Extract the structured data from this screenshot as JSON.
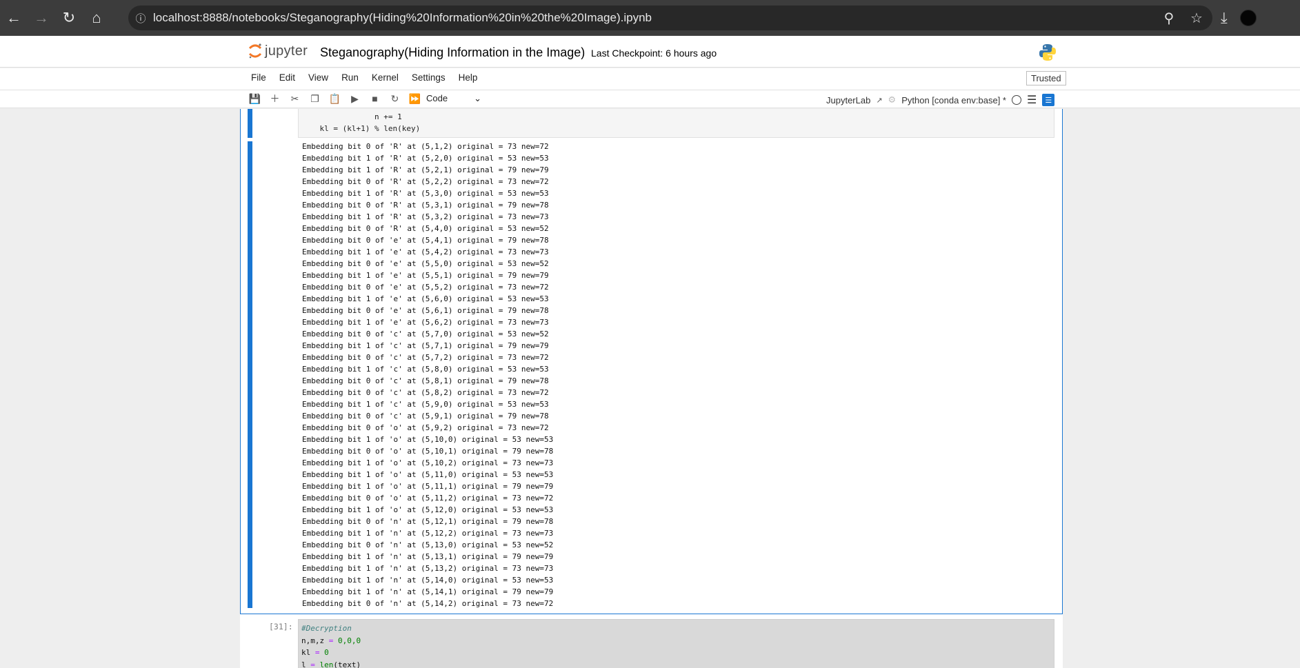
{
  "browser": {
    "url": "localhost:8888/notebooks/Steganography(Hiding%20Information%20in%20the%20Image).ipynb"
  },
  "header": {
    "logo_text": "jupyter",
    "notebook_title": "Steganography(Hiding Information in the Image)",
    "checkpoint": "Last Checkpoint: 6 hours ago"
  },
  "menu": [
    "File",
    "Edit",
    "View",
    "Run",
    "Kernel",
    "Settings",
    "Help"
  ],
  "trusted_label": "Trusted",
  "toolbar": {
    "cell_type": "Code",
    "jupyterlab_label": "JupyterLab",
    "kernel_label": "Python [conda env:base] *"
  },
  "code_tail": {
    "line1": "                n += 1",
    "line2": "    kl = (kl+1) % len(key)"
  },
  "output_lines": [
    "Embedding bit 0 of 'R' at (5,1,2) original = 73 new=72",
    "Embedding bit 1 of 'R' at (5,2,0) original = 53 new=53",
    "Embedding bit 1 of 'R' at (5,2,1) original = 79 new=79",
    "Embedding bit 0 of 'R' at (5,2,2) original = 73 new=72",
    "Embedding bit 1 of 'R' at (5,3,0) original = 53 new=53",
    "Embedding bit 0 of 'R' at (5,3,1) original = 79 new=78",
    "Embedding bit 1 of 'R' at (5,3,2) original = 73 new=73",
    "Embedding bit 0 of 'R' at (5,4,0) original = 53 new=52",
    "Embedding bit 0 of 'e' at (5,4,1) original = 79 new=78",
    "Embedding bit 1 of 'e' at (5,4,2) original = 73 new=73",
    "Embedding bit 0 of 'e' at (5,5,0) original = 53 new=52",
    "Embedding bit 1 of 'e' at (5,5,1) original = 79 new=79",
    "Embedding bit 0 of 'e' at (5,5,2) original = 73 new=72",
    "Embedding bit 1 of 'e' at (5,6,0) original = 53 new=53",
    "Embedding bit 0 of 'e' at (5,6,1) original = 79 new=78",
    "Embedding bit 1 of 'e' at (5,6,2) original = 73 new=73",
    "Embedding bit 0 of 'c' at (5,7,0) original = 53 new=52",
    "Embedding bit 1 of 'c' at (5,7,1) original = 79 new=79",
    "Embedding bit 0 of 'c' at (5,7,2) original = 73 new=72",
    "Embedding bit 1 of 'c' at (5,8,0) original = 53 new=53",
    "Embedding bit 0 of 'c' at (5,8,1) original = 79 new=78",
    "Embedding bit 0 of 'c' at (5,8,2) original = 73 new=72",
    "Embedding bit 1 of 'c' at (5,9,0) original = 53 new=53",
    "Embedding bit 0 of 'c' at (5,9,1) original = 79 new=78",
    "Embedding bit 0 of 'o' at (5,9,2) original = 73 new=72",
    "Embedding bit 1 of 'o' at (5,10,0) original = 53 new=53",
    "Embedding bit 0 of 'o' at (5,10,1) original = 79 new=78",
    "Embedding bit 1 of 'o' at (5,10,2) original = 73 new=73",
    "Embedding bit 1 of 'o' at (5,11,0) original = 53 new=53",
    "Embedding bit 1 of 'o' at (5,11,1) original = 79 new=79",
    "Embedding bit 0 of 'o' at (5,11,2) original = 73 new=72",
    "Embedding bit 1 of 'o' at (5,12,0) original = 53 new=53",
    "Embedding bit 0 of 'n' at (5,12,1) original = 79 new=78",
    "Embedding bit 1 of 'n' at (5,12,2) original = 73 new=73",
    "Embedding bit 0 of 'n' at (5,13,0) original = 53 new=52",
    "Embedding bit 1 of 'n' at (5,13,1) original = 79 new=79",
    "Embedding bit 1 of 'n' at (5,13,2) original = 73 new=73",
    "Embedding bit 1 of 'n' at (5,14,0) original = 53 new=53",
    "Embedding bit 1 of 'n' at (5,14,1) original = 79 new=79",
    "Embedding bit 0 of 'n' at (5,14,2) original = 73 new=72"
  ],
  "cell2": {
    "prompt": "[31]:",
    "comment": "#Decryption",
    "line2_a": "n,m,z ",
    "line2_b": "=",
    "line2_c": " 0,0,0",
    "line3_a": "kl ",
    "line3_b": "=",
    "line3_c": " 0",
    "line4_a": "l ",
    "line4_b": "=",
    "line4_c": " len",
    "line4_d": "(text)"
  },
  "colors": {
    "accent": "#1976d2",
    "browser_bg": "#3c3c3c",
    "omnibox_bg": "#282828"
  }
}
